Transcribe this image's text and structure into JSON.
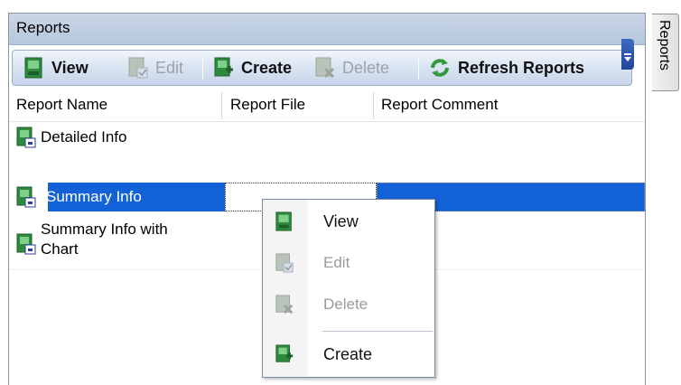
{
  "panel": {
    "title": "Reports"
  },
  "toolbar": {
    "view": "View",
    "edit": "Edit",
    "create": "Create",
    "delete": "Delete",
    "refresh": "Refresh Reports"
  },
  "grid": {
    "columns": [
      "Report Name",
      "Report File",
      "Report Comment"
    ],
    "rows": [
      {
        "name": "Detailed Info",
        "file": "",
        "comment": "",
        "selected": false
      },
      {
        "name": "Summary Info",
        "file": "",
        "comment": "",
        "selected": true
      },
      {
        "name_line1": "Summary Info with",
        "name_line2": "Chart",
        "file": "",
        "comment": "",
        "selected": false
      }
    ]
  },
  "context_menu": {
    "items": [
      {
        "label": "View",
        "enabled": true,
        "icon": "report-view-icon"
      },
      {
        "label": "Edit",
        "enabled": false,
        "icon": "report-edit-icon"
      },
      {
        "label": "Delete",
        "enabled": false,
        "icon": "report-delete-icon"
      },
      {
        "label": "Create",
        "enabled": true,
        "icon": "report-create-icon"
      }
    ]
  },
  "side_tab": {
    "label": "Reports"
  },
  "colors": {
    "selection": "#1261d6",
    "title_bar": "#c9d6e6",
    "icon_green": "#3a9a4a"
  }
}
